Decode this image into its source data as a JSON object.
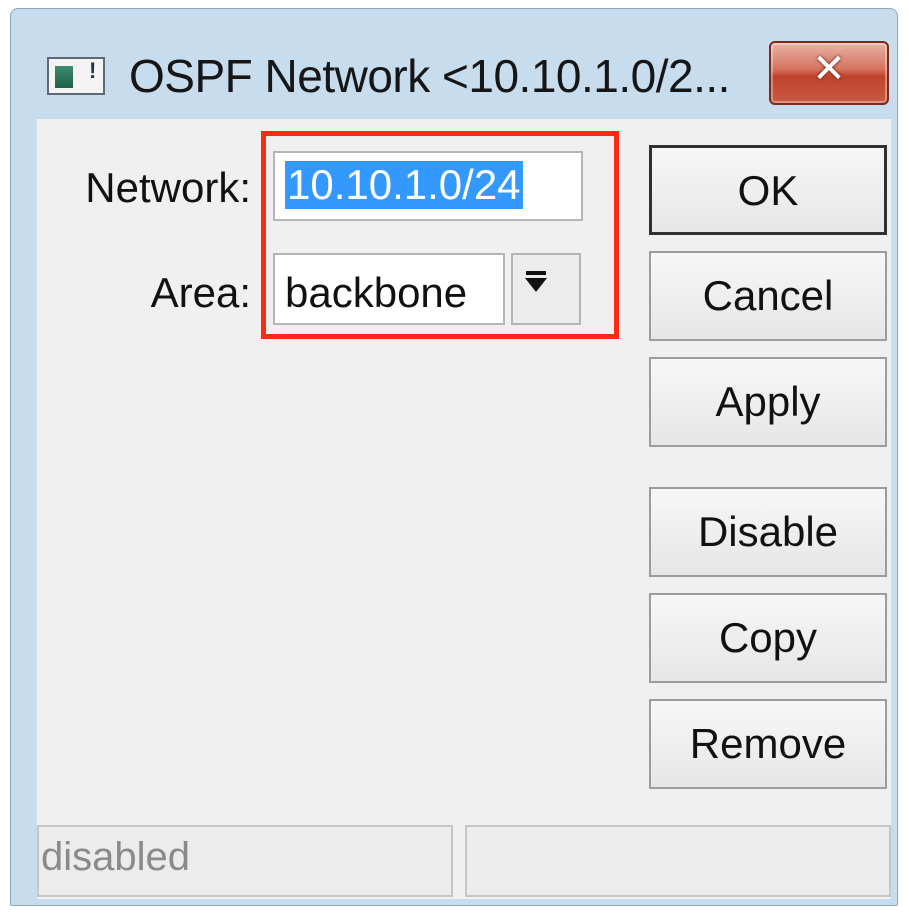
{
  "window": {
    "title": "OSPF Network <10.10.1.0/2...",
    "close_label": "✕"
  },
  "form": {
    "network_label": "Network:",
    "network_value": "10.10.1.0/24",
    "area_label": "Area:",
    "area_value": "backbone"
  },
  "buttons": {
    "ok": "OK",
    "cancel": "Cancel",
    "apply": "Apply",
    "disable": "Disable",
    "copy": "Copy",
    "remove": "Remove"
  },
  "status": {
    "left": "disabled",
    "right": ""
  },
  "colors": {
    "highlight": "#ff2a14",
    "selection": "#3399ff",
    "close_button": "#c0432c"
  },
  "icons": {
    "app": "mikrotik-window-icon",
    "close": "close-icon",
    "dropdown": "arrow-down-to-bar-icon"
  }
}
